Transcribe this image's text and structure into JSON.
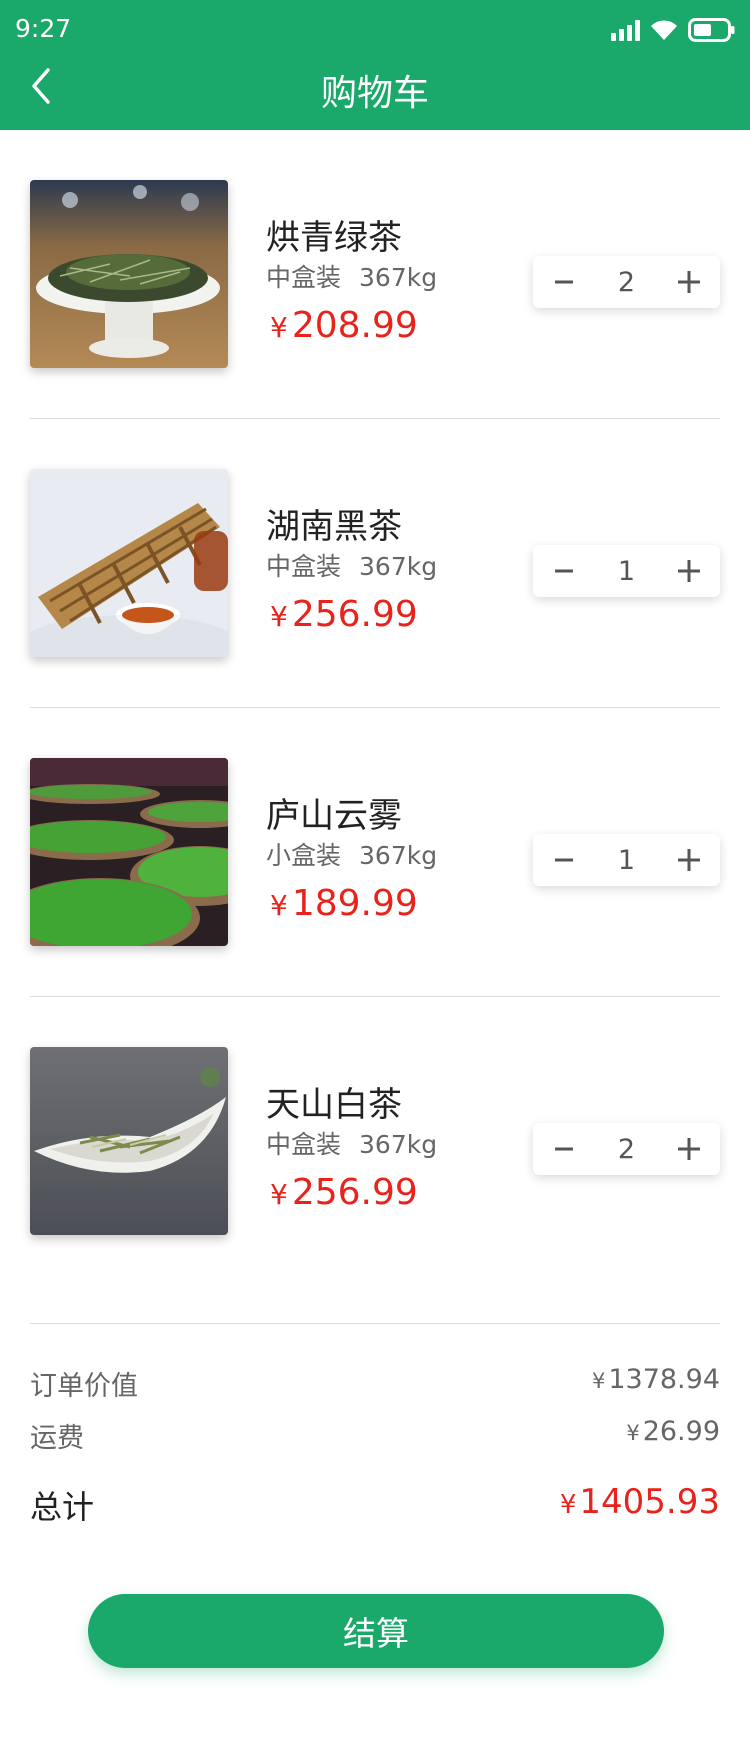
{
  "status_bar": {
    "time": "9:27"
  },
  "header": {
    "title": "购物车",
    "back_icon": "chevron-left-icon"
  },
  "colors": {
    "brand": "#1aa86b",
    "price": "#e8231c"
  },
  "currency_symbol": "¥",
  "items": [
    {
      "name": "烘青绿茶",
      "package": "中盒装",
      "weight": "367kg",
      "price": "208.99",
      "quantity": "2"
    },
    {
      "name": "湖南黑茶",
      "package": "中盒装",
      "weight": "367kg",
      "price": "256.99",
      "quantity": "1"
    },
    {
      "name": "庐山云雾",
      "package": "小盒装",
      "weight": "367kg",
      "price": "189.99",
      "quantity": "1"
    },
    {
      "name": "天山白茶",
      "package": "中盒装",
      "weight": "367kg",
      "price": "256.99",
      "quantity": "2"
    }
  ],
  "summary": {
    "order_value_label": "订单价值",
    "order_value": "1378.94",
    "shipping_label": "运费",
    "shipping": "26.99",
    "total_label": "总计",
    "total": "1405.93"
  },
  "checkout_label": "结算"
}
